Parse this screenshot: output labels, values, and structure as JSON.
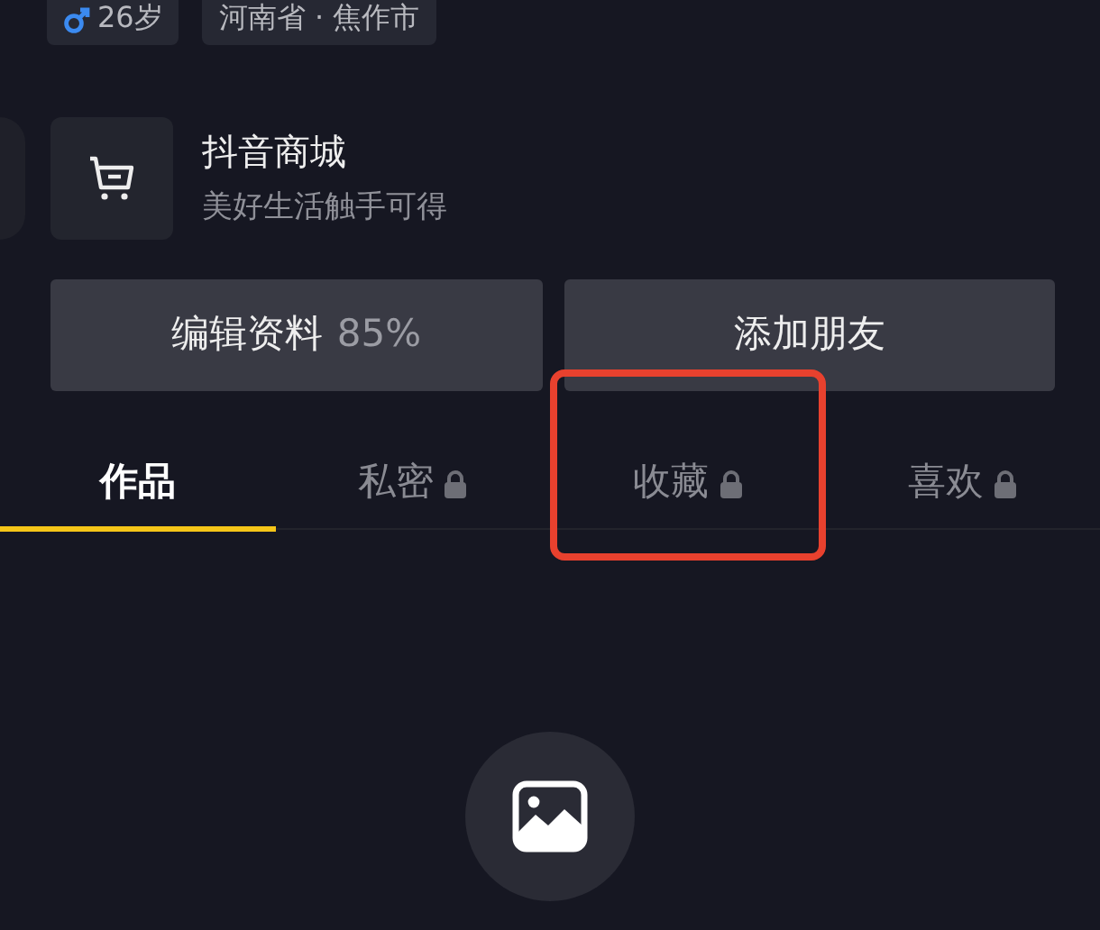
{
  "profile_tags": [
    {
      "kind": "gender",
      "text": "26岁"
    },
    {
      "kind": "plain",
      "text": "河南省 · 焦作市"
    }
  ],
  "shop": {
    "title": "抖音商城",
    "subtitle": "美好生活触手可得"
  },
  "buttons": [
    {
      "label": "编辑资料",
      "extra": "85%"
    },
    {
      "label": "添加朋友"
    }
  ],
  "tabs": [
    {
      "label": "作品",
      "selected": true,
      "locked": false,
      "highlighted": false
    },
    {
      "label": "私密",
      "selected": false,
      "locked": true,
      "highlighted": false
    },
    {
      "label": "收藏",
      "selected": false,
      "locked": true,
      "highlighted": true
    },
    {
      "label": "喜欢",
      "selected": false,
      "locked": true,
      "highlighted": false
    }
  ]
}
